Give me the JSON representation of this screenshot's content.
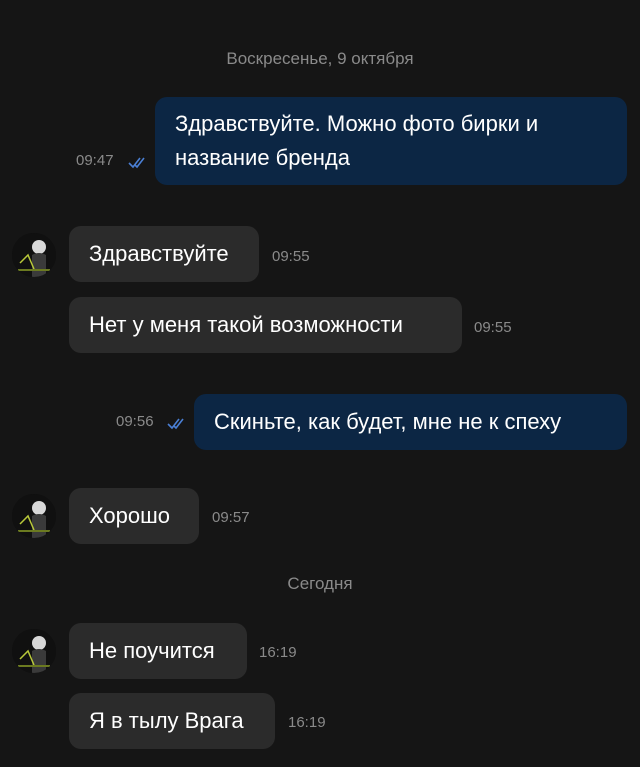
{
  "dates": {
    "first": "Воскресенье, 9 октября",
    "second": "Сегодня"
  },
  "messages": [
    {
      "dir": "out",
      "lines": [
        "Здравствуйте. Можно фото бирки и",
        "название бренда"
      ],
      "time": "09:47",
      "status": "read"
    },
    {
      "dir": "in",
      "text": "Здравствуйте",
      "time": "09:55"
    },
    {
      "dir": "in",
      "text": "Нет у меня такой возможности",
      "time": "09:55"
    },
    {
      "dir": "out",
      "text": "Скиньте, как будет, мне не к спеху",
      "time": "09:56",
      "status": "read"
    },
    {
      "dir": "in",
      "text": "Хорошо",
      "time": "09:57"
    },
    {
      "dir": "in",
      "text": "Не поучится",
      "time": "16:19"
    },
    {
      "dir": "in",
      "text": "Я в тылу Врага",
      "time": "16:19"
    }
  ],
  "colors": {
    "background": "#151515",
    "incoming_bubble": "#2b2b2b",
    "outgoing_bubble": "#0c2644",
    "read_check": "#4a7fd4",
    "meta_text": "#8a8a8a"
  },
  "icons": {
    "read_status": "double-check-icon",
    "contact_avatar": "avatar"
  }
}
